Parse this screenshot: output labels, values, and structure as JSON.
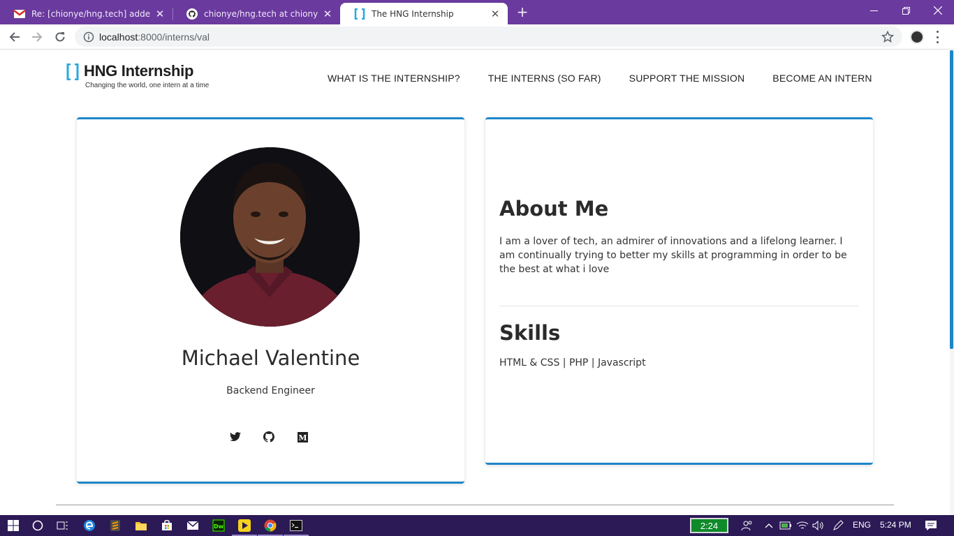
{
  "browser": {
    "tabs": [
      {
        "title": "Re: [chionye/hng.tech] added a n",
        "favicon": "gmail-icon",
        "active": false
      },
      {
        "title": "chionye/hng.tech at chionye-pat",
        "favicon": "github-icon",
        "active": false
      },
      {
        "title": "The HNG Internship",
        "favicon": "hng-icon",
        "active": true
      }
    ],
    "url": {
      "host": "localhost",
      "path": ":8000/interns/val"
    },
    "accent": "#6a3a9e"
  },
  "site": {
    "logo": {
      "brand": "HNG Internship",
      "tagline": "Changing the world, one intern at a time"
    },
    "nav": [
      "WHAT IS THE INTERNSHIP?",
      "THE INTERNS (SO FAR)",
      "SUPPORT THE MISSION",
      "BECOME AN INTERN"
    ],
    "accent": "#1c86c9"
  },
  "profile": {
    "name": "Michael Valentine",
    "role": "Backend Engineer",
    "socials": [
      "twitter-icon",
      "github-icon",
      "medium-icon"
    ]
  },
  "about": {
    "title": "About Me",
    "text": "I am a lover of tech, an admirer of innovations and a lifelong learner. I am continually trying to better my skills at programming in order to be the best at what i love",
    "skills_title": "Skills",
    "skills": "HTML & CSS | PHP | Javascript"
  },
  "taskbar": {
    "battery": "2:24",
    "language": "ENG",
    "time": "5:24 PM"
  }
}
